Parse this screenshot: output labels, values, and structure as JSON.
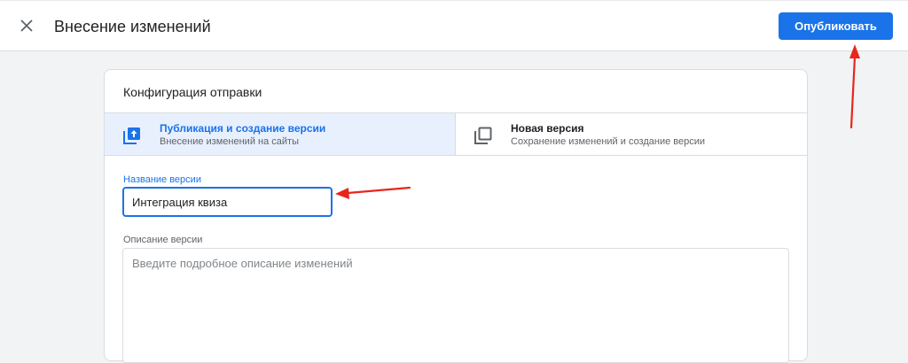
{
  "header": {
    "title": "Внесение изменений",
    "close_icon": "close-icon",
    "publish_label": "Опубликовать"
  },
  "card": {
    "title": "Конфигурация отправки",
    "tabs": [
      {
        "title": "Публикация и создание версии",
        "subtitle": "Внесение изменений на сайты",
        "icon": "publish-upload-icon",
        "selected": true
      },
      {
        "title": "Новая версия",
        "subtitle": "Сохранение изменений и создание версии",
        "icon": "copy-version-icon",
        "selected": false
      }
    ],
    "version_name": {
      "label": "Название версии",
      "value": "Интеграция квиза"
    },
    "version_description": {
      "label": "Описание версии",
      "placeholder": "Введите подробное описание изменений",
      "value": ""
    }
  },
  "colors": {
    "accent": "#1a73e8",
    "annotation_arrow": "#e8261c",
    "selected_tab_bg": "#e8f0fe"
  }
}
